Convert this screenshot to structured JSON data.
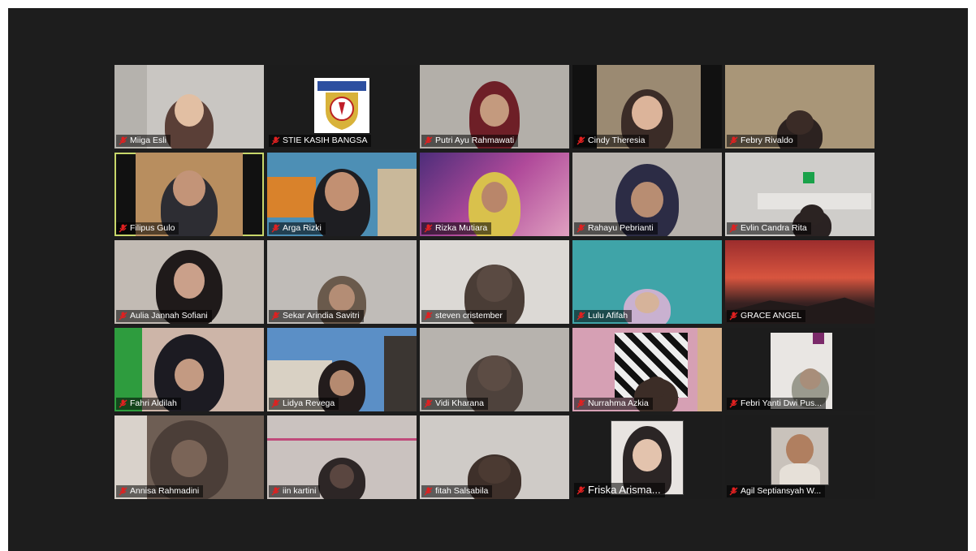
{
  "participants": [
    {
      "name": "Miiga Esli",
      "bg": "#bfbfbd",
      "mic": "muted-mic-icon"
    },
    {
      "name": "STIE KASIH BANGSA",
      "bg": "#1c1c1c",
      "mic": "muted-mic-icon"
    },
    {
      "name": "Putri Ayu Rahmawati",
      "bg": "#b9b5ae",
      "mic": "muted-mic-icon"
    },
    {
      "name": "Cindy Theresia",
      "bg": "#8d7a63",
      "mic": "muted-mic-icon"
    },
    {
      "name": "Febry Rivaldo",
      "bg": "#a89576",
      "mic": "muted-mic-icon"
    },
    {
      "name": "Filipus Gulo",
      "bg": "#b88e5f",
      "mic": "muted-mic-icon"
    },
    {
      "name": "Arga Rizki",
      "bg": "#4a90b8",
      "mic": "muted-mic-icon"
    },
    {
      "name": "Rizka Mutiara",
      "bg": "#7b4a9c",
      "mic": "muted-mic-icon"
    },
    {
      "name": "Rahayu Pebrianti",
      "bg": "#b7b2ad",
      "mic": "muted-mic-icon"
    },
    {
      "name": "Evlin Candra Rita",
      "bg": "#c9c7c4",
      "mic": "muted-mic-icon"
    },
    {
      "name": "Aulia Jannah Sofiani",
      "bg": "#c2bbb4",
      "mic": "muted-mic-icon"
    },
    {
      "name": "Sekar Arindia Savitri",
      "bg": "#c0bcb8",
      "mic": "muted-mic-icon"
    },
    {
      "name": "steven cristember",
      "bg": "#d6d3cf",
      "mic": "muted-mic-icon"
    },
    {
      "name": "Lulu Afifah",
      "bg": "#3fa4a8",
      "mic": "muted-mic-icon"
    },
    {
      "name": "GRACE ANGEL",
      "bg": "#b4433a",
      "mic": "muted-mic-icon"
    },
    {
      "name": "Fahri Aldilah",
      "bg": "#4a9a4f",
      "mic": "muted-mic-icon"
    },
    {
      "name": "Lidya Revega",
      "bg": "#5b8fc6",
      "mic": "muted-mic-icon"
    },
    {
      "name": "Vidi Kharana",
      "bg": "#b7b3ae",
      "mic": "muted-mic-icon"
    },
    {
      "name": "Nurrahma Azkia",
      "bg": "#8f6a5a",
      "mic": "muted-mic-icon"
    },
    {
      "name": "Febri Yanti Dwi Pus...",
      "bg": "#1c1c1c",
      "mic": "muted-mic-icon"
    },
    {
      "name": "Annisa Rahmadini",
      "bg": "#7d6a5e",
      "mic": "muted-mic-icon"
    },
    {
      "name": "iin kartini",
      "bg": "#c9c0bd",
      "mic": "muted-mic-icon"
    },
    {
      "name": "fitah Salsabila",
      "bg": "#cfcbc7",
      "mic": "muted-mic-icon"
    },
    {
      "name": "Friska Arisma...",
      "bg": "#1c1c1c",
      "mic": "muted-mic-icon"
    },
    {
      "name": "Agil Septiansyah W...",
      "bg": "#1c1c1c",
      "mic": "muted-mic-icon"
    }
  ],
  "active_speaker": "Filipus Gulo",
  "colors": {
    "meeting_bg": "#1d1d1d",
    "active_outline": "#c8d76a",
    "muted_mic": "#e02020"
  }
}
